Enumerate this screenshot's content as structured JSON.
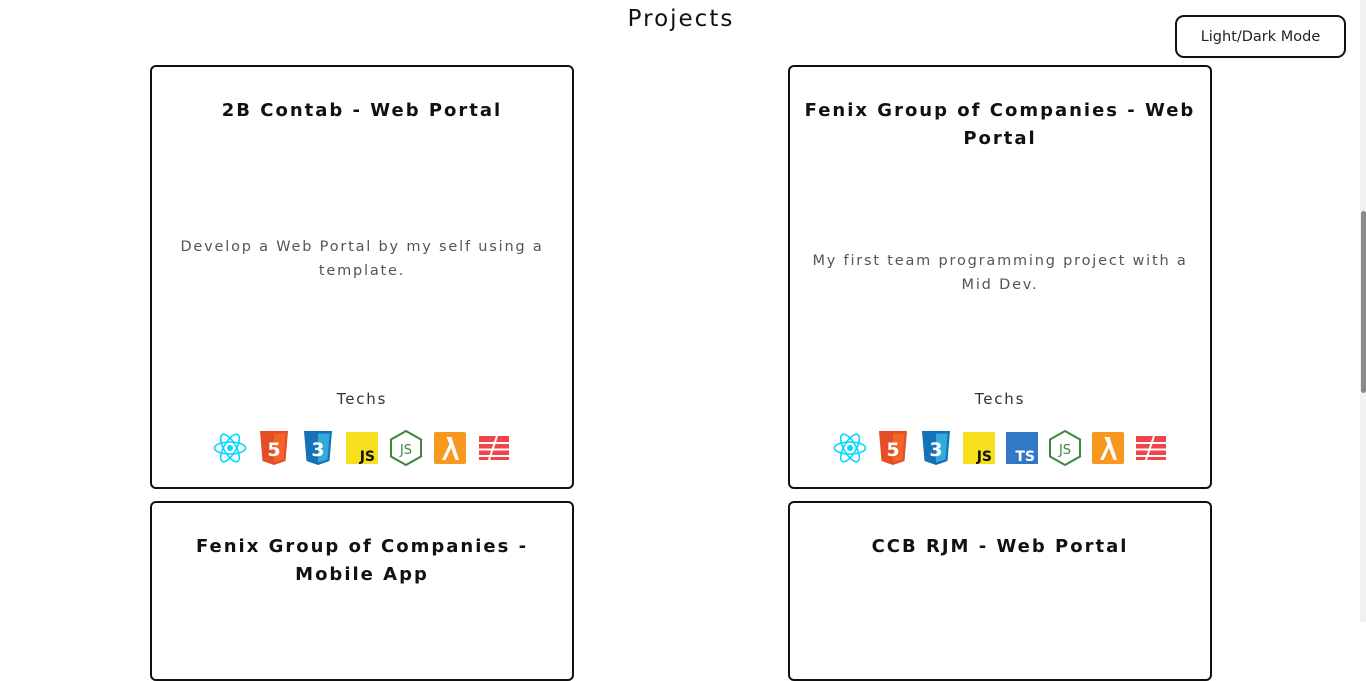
{
  "page": {
    "title": "Projects"
  },
  "mode_toggle": {
    "label": "Light/Dark Mode"
  },
  "projects": [
    {
      "title": "2B Contab - Web Portal",
      "description": "Develop a Web Portal by my self using a template.",
      "techs_label": "Techs",
      "techs": [
        "react-icon",
        "html5-icon",
        "css3-icon",
        "javascript-icon",
        "nodejs-icon",
        "aws-lambda-icon",
        "laravel-icon"
      ]
    },
    {
      "title": "Fenix Group of Companies - Web Portal",
      "description": "My first team programming project with a Mid Dev.",
      "techs_label": "Techs",
      "techs": [
        "react-icon",
        "html5-icon",
        "css3-icon",
        "javascript-icon",
        "typescript-icon",
        "nodejs-icon",
        "aws-lambda-icon",
        "laravel-icon"
      ]
    },
    {
      "title": "Fenix Group of Companies - Mobile App"
    },
    {
      "title": "CCB RJM - Web Portal"
    }
  ],
  "colors": {
    "react": "#00d8ff",
    "html5": "#e44d26",
    "css3": "#1572b6",
    "javascript": "#f7df1e",
    "typescript": "#3178c6",
    "nodejs": "#3c873a",
    "aws_lambda": "#f7981f",
    "laravel": "#f0444a"
  }
}
